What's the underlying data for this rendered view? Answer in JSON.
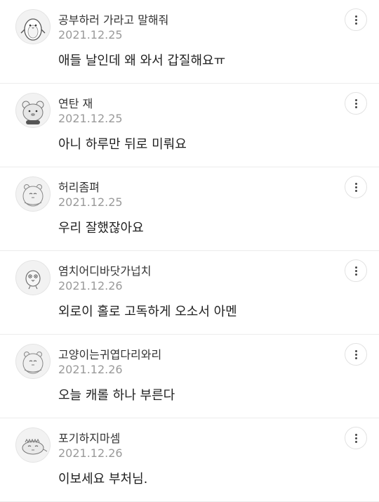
{
  "comments": [
    {
      "nickname": "공부하러 가라고 말해줘",
      "date": "2021.12.25",
      "text": "애들 날인데 왜 와서 갑질해요ㅠ",
      "avatar_icon": "penguin-icon"
    },
    {
      "nickname": "연탄 재",
      "date": "2021.12.25",
      "text": "아니 하루만 뒤로 미뤄요",
      "avatar_icon": "bear-icon"
    },
    {
      "nickname": "허리좀펴",
      "date": "2021.12.25",
      "text": "우리 잘했잖아요",
      "avatar_icon": "hamster-icon"
    },
    {
      "nickname": "염치어디바닷가넙치",
      "date": "2021.12.26",
      "text": "외로이 홀로 고독하게 오소서 아멘",
      "avatar_icon": "chick-icon"
    },
    {
      "nickname": "고양이는귀엽다리와리",
      "date": "2021.12.26",
      "text": "오늘 캐롤 하나 부른다",
      "avatar_icon": "hamster-icon"
    },
    {
      "nickname": "포기하지마셈",
      "date": "2021.12.26",
      "text": "이보세요 부처님.",
      "avatar_icon": "dinosaur-icon"
    }
  ],
  "more_button_icon": "more-vertical-icon"
}
